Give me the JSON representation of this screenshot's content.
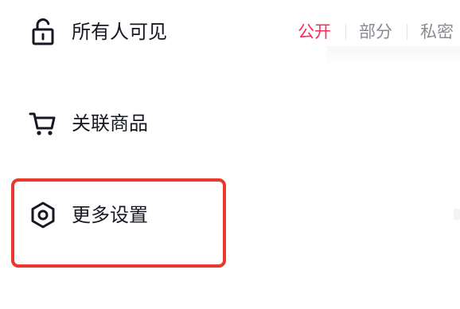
{
  "visibility": {
    "icon": "unlock-icon",
    "label": "所有人可见",
    "options": [
      "公开",
      "部分",
      "私密"
    ],
    "selected_index": 0,
    "accent_color": "#fe2c55"
  },
  "products": {
    "icon": "shopping-cart-icon",
    "label": "关联商品"
  },
  "more_settings": {
    "icon": "hexagon-settings-icon",
    "label": "更多设置",
    "highlight_color": "#e8392c"
  }
}
